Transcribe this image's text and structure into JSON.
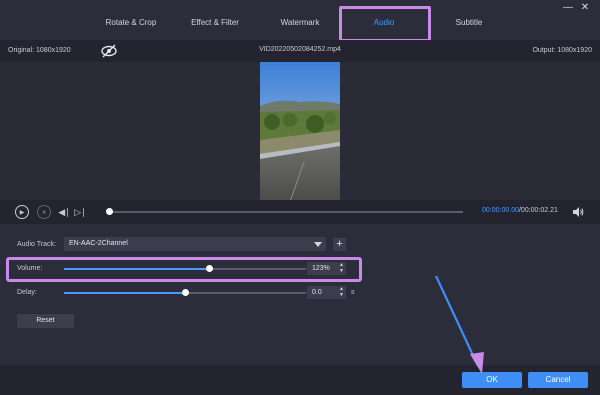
{
  "tabs": [
    {
      "label": "Rotate & Crop",
      "active": false
    },
    {
      "label": "Effect & Filter",
      "active": false
    },
    {
      "label": "Watermark",
      "active": false
    },
    {
      "label": "Audio",
      "active": true
    },
    {
      "label": "Subtitle",
      "active": false
    }
  ],
  "window": {
    "minimize_icon": "minimize-icon",
    "close_icon": "close-icon"
  },
  "info": {
    "original": "Original: 1080x1920",
    "filename": "VID20220502084252.mp4",
    "output": "Output: 1080x1920",
    "eye_icon": "eye-slash-icon"
  },
  "playback": {
    "progress": 0.0,
    "current_time": "00:00:00.00",
    "total_time": "/00:00:02.21",
    "icons": [
      "play-icon",
      "stop-icon",
      "previous-frame-icon",
      "next-frame-icon",
      "volume-icon"
    ]
  },
  "audio": {
    "track_label": "Audio Track:",
    "track_value": "EN-AAC-2Channel",
    "add_label": "+",
    "volume_label": "Volume:",
    "volume_value": "123%",
    "volume_level": 0.6,
    "delay_label": "Delay:",
    "delay_value": "0.0",
    "delay_unit": "s",
    "delay_level": 0.5,
    "reset_label": "Reset"
  },
  "footer": {
    "ok_label": "OK",
    "cancel_label": "Cancel"
  },
  "colors": {
    "accent": "#4a9bff",
    "button": "#3e8ef5",
    "highlight": "#c98ae8",
    "background": "#2b2d3a"
  }
}
